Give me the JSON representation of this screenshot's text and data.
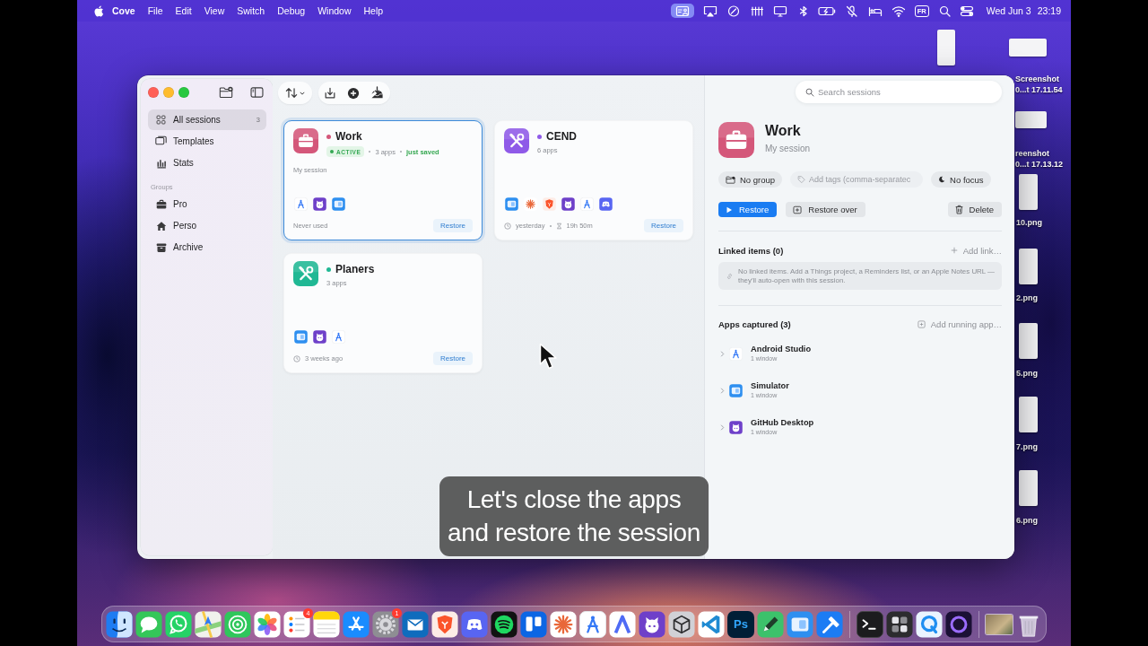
{
  "menu_bar": {
    "app_name": "Cove",
    "menus": [
      "File",
      "Edit",
      "View",
      "Switch",
      "Debug",
      "Window",
      "Help"
    ],
    "extras": [
      {
        "kind": "presenter",
        "on": true
      },
      {
        "kind": "mirror",
        "on": false
      },
      {
        "kind": "compass",
        "on": false
      },
      {
        "kind": "bars",
        "on": false
      },
      {
        "kind": "monitor",
        "on": false
      },
      {
        "kind": "bluetooth",
        "on": false
      },
      {
        "kind": "battery",
        "on": false
      },
      {
        "kind": "mute",
        "on": false
      },
      {
        "kind": "bed",
        "on": false
      },
      {
        "kind": "wifi",
        "on": false
      },
      {
        "kind": "input",
        "text": "FR",
        "on": false
      },
      {
        "kind": "search",
        "on": false
      },
      {
        "kind": "control",
        "on": false
      }
    ],
    "date": "Wed Jun 3",
    "time": "23:19"
  },
  "desktop_icons": [
    {
      "label_lines": [
        "Screenshot",
        "0...t 17.11.54"
      ]
    },
    {
      "label_lines": [
        "reenshot",
        "0...t 17.13.12"
      ]
    },
    {
      "label_lines": [
        "10.png"
      ]
    },
    {
      "label_lines": [
        "2.png"
      ]
    },
    {
      "label_lines": [
        "5.png"
      ]
    },
    {
      "label_lines": [
        "7.png"
      ]
    },
    {
      "label_lines": [
        "6.png"
      ]
    }
  ],
  "sidebar": {
    "items": [
      {
        "label": "All sessions",
        "count": "3",
        "kind": "grid",
        "selected": true
      },
      {
        "label": "Templates",
        "kind": "stack",
        "selected": false
      },
      {
        "label": "Stats",
        "kind": "bars",
        "selected": false
      }
    ],
    "groups_heading": "Groups",
    "groups": [
      {
        "label": "Pro",
        "kind": "briefcase",
        "selected": false
      },
      {
        "label": "Perso",
        "kind": "house",
        "selected": false
      },
      {
        "label": "Archive",
        "kind": "archive",
        "selected": false
      }
    ]
  },
  "cards": [
    {
      "name": "Work",
      "color": "#d4577a",
      "kind": "briefcase",
      "selected": true,
      "badge": "ACTIVE",
      "apps": "3 apps",
      "note": "just saved",
      "description": "My session",
      "app_icons": [
        {
          "kind": "compass"
        },
        {
          "kind": "cat"
        },
        {
          "kind": "window"
        }
      ],
      "footer": [
        {
          "kind": "plain",
          "text": "Never used"
        }
      ],
      "action": "Restore"
    },
    {
      "name": "CEND",
      "color": "#8f5ae8",
      "kind": "tools",
      "selected": false,
      "apps": "6 apps",
      "app_icons": [
        {
          "kind": "window"
        },
        {
          "kind": "burst"
        },
        {
          "kind": "shield"
        },
        {
          "kind": "cat"
        },
        {
          "kind": "compass"
        },
        {
          "kind": "gamepad"
        }
      ],
      "footer": [
        {
          "kind": "clock",
          "text": "yesterday"
        },
        {
          "kind": "hourglass",
          "text": "19h 50m"
        }
      ],
      "action": "Restore"
    },
    {
      "name": "Planers",
      "color": "#20b894",
      "kind": "tools",
      "selected": false,
      "apps": "3 apps",
      "app_icons": [
        {
          "kind": "window"
        },
        {
          "kind": "cat"
        },
        {
          "kind": "compass"
        }
      ],
      "footer": [
        {
          "kind": "clock",
          "text": "3 weeks ago"
        }
      ],
      "action": "Restore"
    }
  ],
  "search": {
    "placeholder": "Search sessions"
  },
  "detail": {
    "title": "Work",
    "subtitle": "My session",
    "group": "No group",
    "tags_placeholder": "Add tags (comma-separatec",
    "focus": "No focus",
    "restore": "Restore",
    "restore_over": "Restore over",
    "delete": "Delete",
    "linked": {
      "heading": "Linked items (0)",
      "add": "Add link…",
      "empty": "No linked items. Add a Things project, a Reminders list, or an Apple Notes URL — they'll auto-open with this session."
    },
    "apps": {
      "heading": "Apps captured (3)",
      "add": "Add running app…",
      "items": [
        {
          "name": "Android Studio",
          "detail": "1 window",
          "kind": "compass",
          "expanded": false
        },
        {
          "name": "Simulator",
          "detail": "1 window",
          "kind": "window",
          "expanded": false
        },
        {
          "name": "GitHub Desktop",
          "detail": "1 window",
          "kind": "cat",
          "expanded": false
        }
      ]
    }
  },
  "caption": {
    "lines": [
      "Let's close the apps",
      "and restore the session"
    ]
  },
  "dock": {
    "badges": [
      "4",
      "1"
    ],
    "tile_label": "Ps"
  }
}
